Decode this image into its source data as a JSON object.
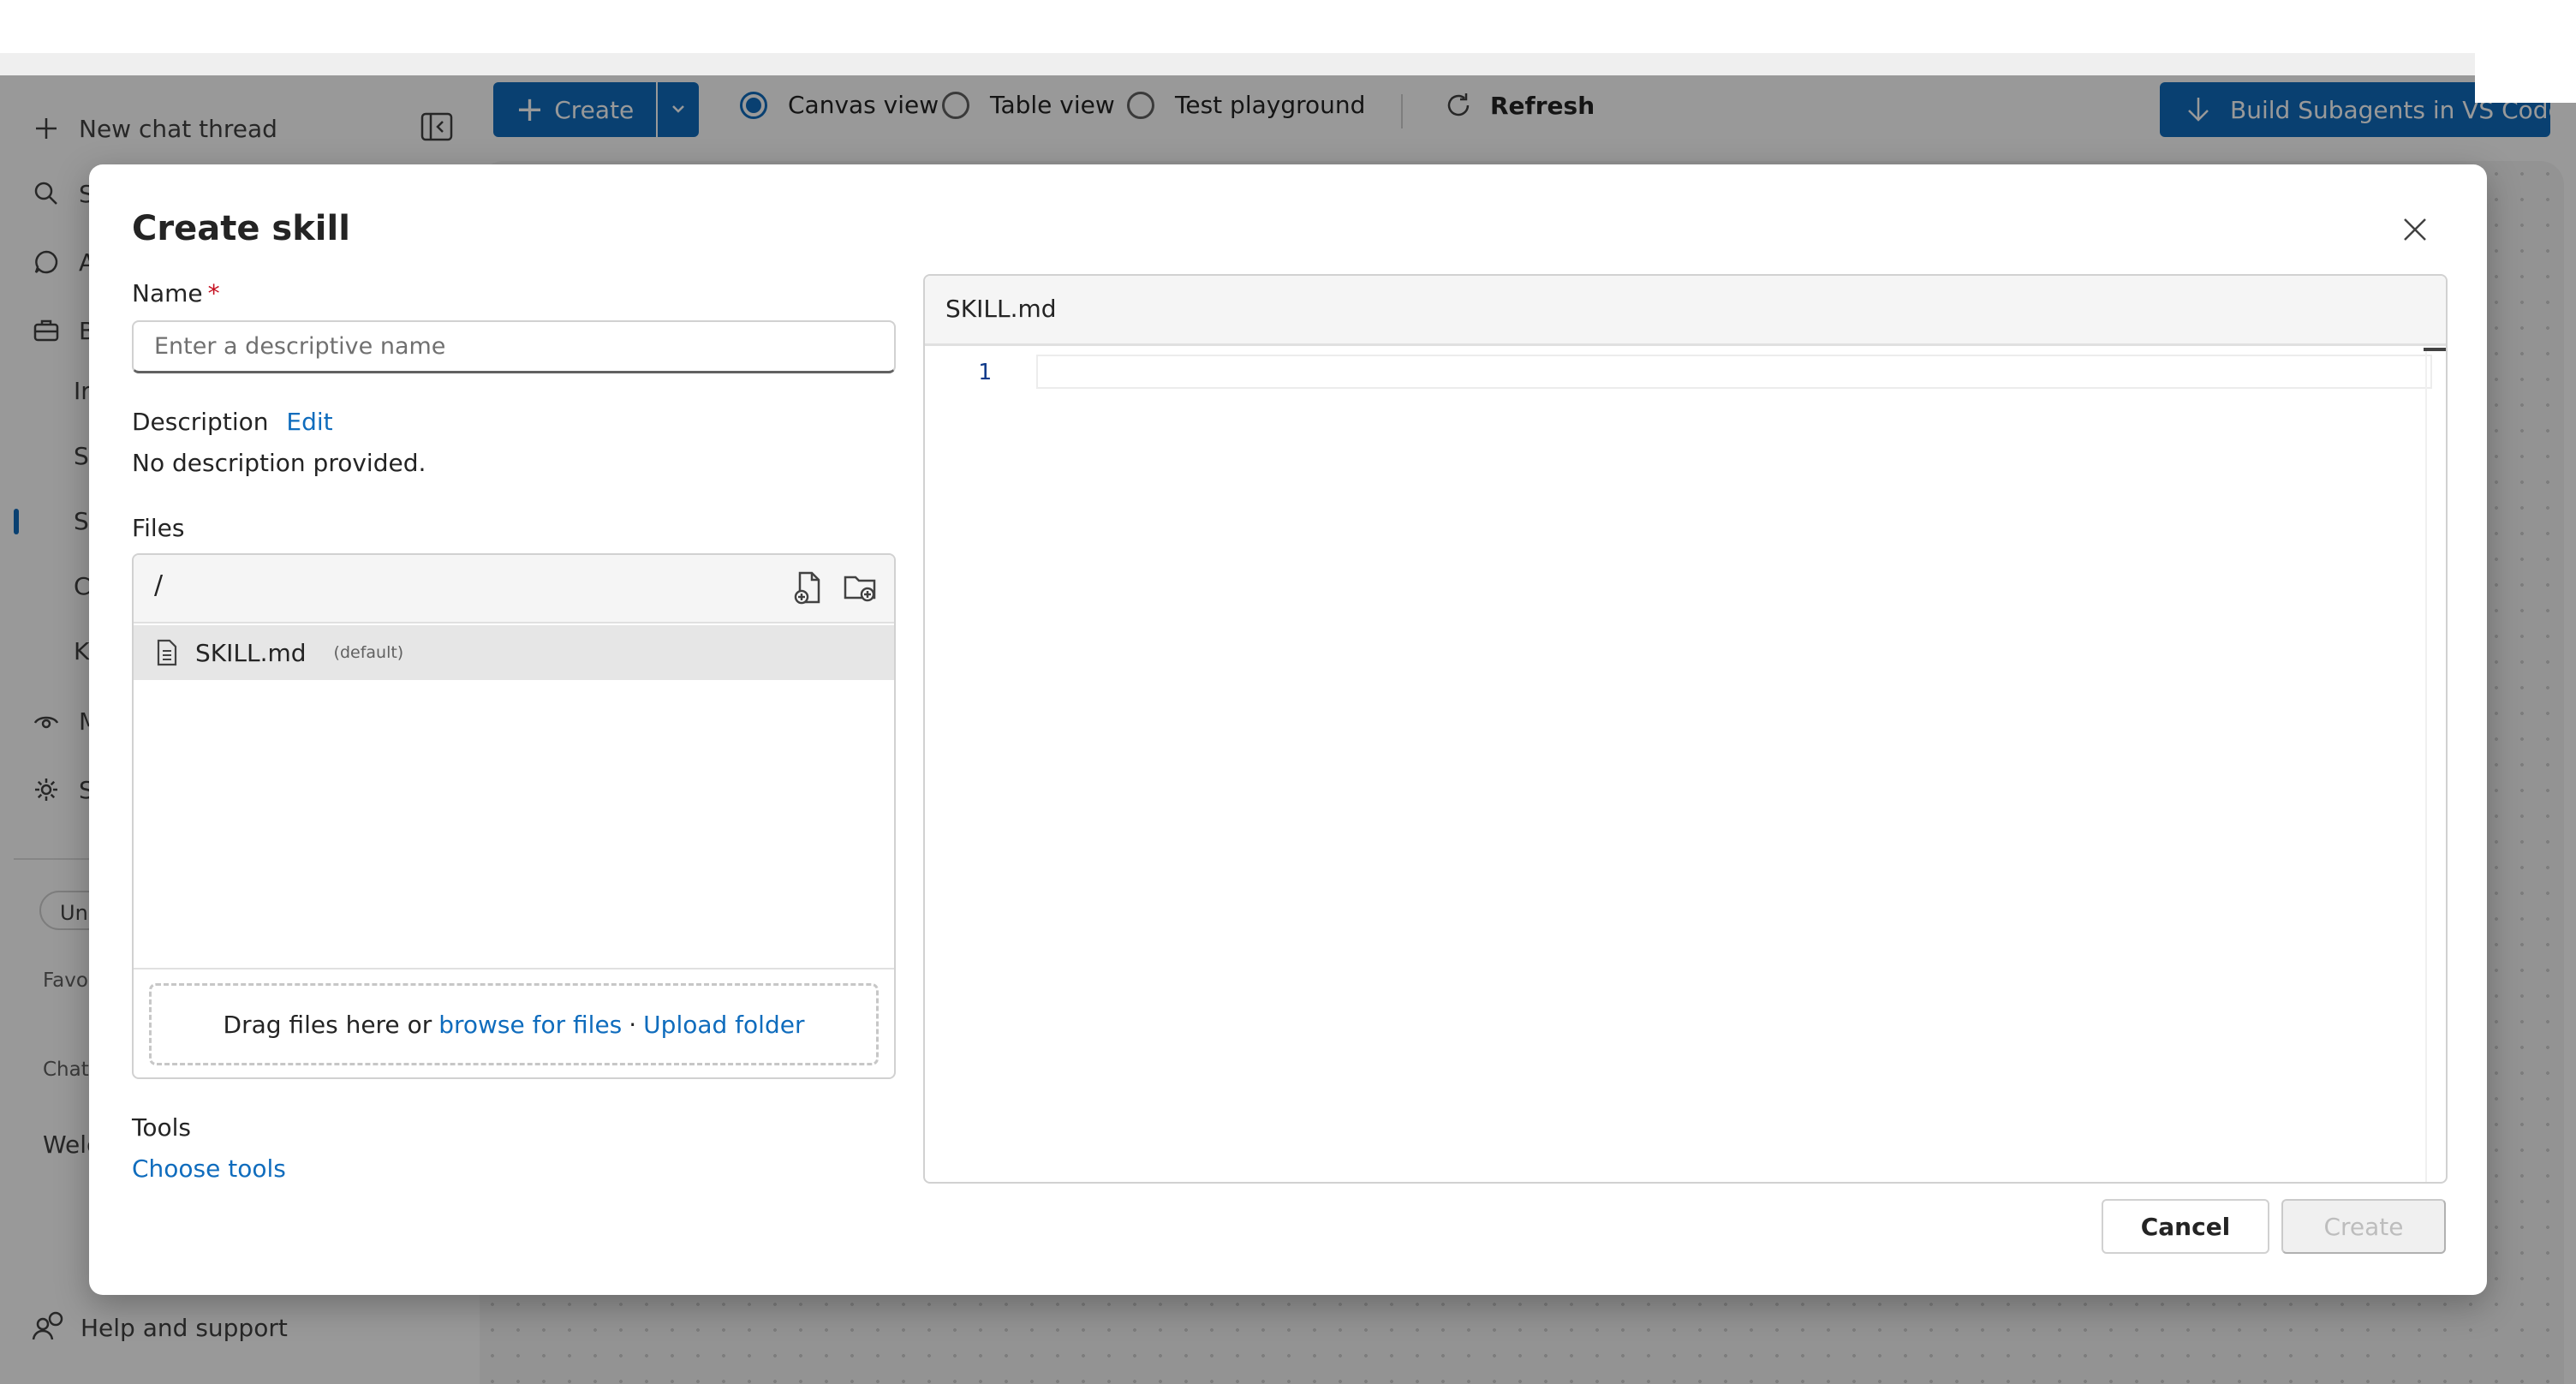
{
  "sidebar": {
    "new_chat": "New chat thread",
    "items": [
      {
        "label": "S",
        "icon": "search-icon"
      },
      {
        "label": "A",
        "icon": "chat-bubble-icon"
      },
      {
        "label": "B",
        "icon": "briefcase-icon"
      }
    ],
    "sub_items": [
      "Ir",
      "Sc",
      "S",
      "C",
      "K"
    ],
    "lower_items": [
      {
        "label": "M",
        "icon": "eye-icon"
      },
      {
        "label": "S",
        "icon": "gear-icon"
      }
    ],
    "pill": "Un",
    "favorites": "Favor",
    "chats": "Chats",
    "welcome": "Welc",
    "help": "Help and support"
  },
  "toolbar": {
    "create": "Create",
    "views": [
      "Canvas view",
      "Table view",
      "Test playground"
    ],
    "selected_view": "Canvas view",
    "refresh": "Refresh",
    "build": "Build Subagents in VS Code"
  },
  "dialog": {
    "title": "Create skill",
    "name_label": "Name",
    "name_required_mark": "*",
    "name_placeholder": "Enter a descriptive name",
    "name_value": "",
    "description_label": "Description",
    "description_edit": "Edit",
    "description_value": "No description provided.",
    "files_label": "Files",
    "files_path": "/",
    "files": [
      {
        "name": "SKILL.md",
        "tag": "(default)"
      }
    ],
    "drop_text": "Drag files here or",
    "browse_link": "browse for files",
    "separator": "·",
    "upload_link": "Upload folder",
    "tools_label": "Tools",
    "tools_link": "Choose tools",
    "editor_tab": "SKILL.md",
    "editor_line_numbers": [
      "1"
    ],
    "cancel": "Cancel",
    "create": "Create"
  },
  "colors": {
    "accent": "#0f6cbd",
    "required": "#c50f1f",
    "disabled_text": "#bdbdbd"
  }
}
